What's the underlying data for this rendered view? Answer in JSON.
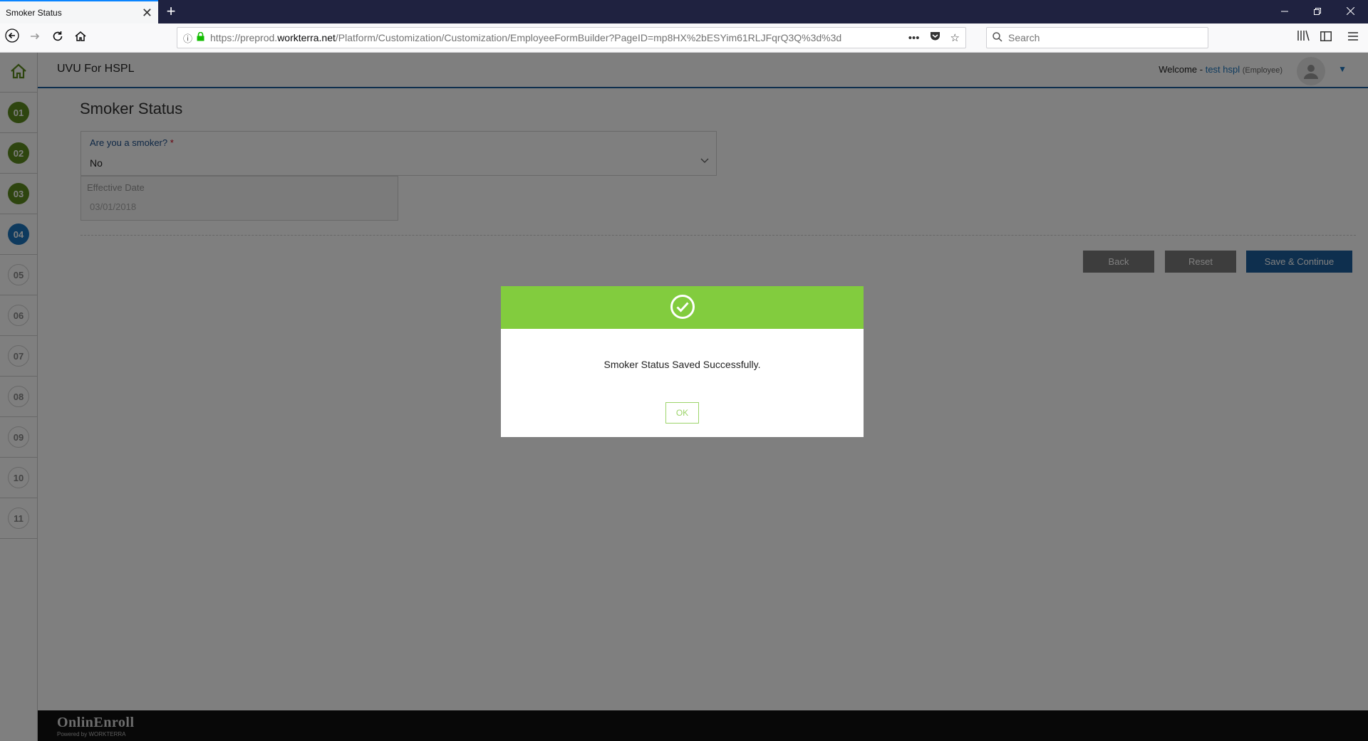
{
  "browser": {
    "tab_title": "Smoker Status",
    "tab_close": "✕",
    "new_tab": "+",
    "url_prefix": "https://preprod.",
    "url_domain": "workterra.net",
    "url_path": "/Platform/Customization/Customization/EmployeeFormBuilder?PageID=mp8HX%2bESYim61RLJFqrQ3Q%3d%3d",
    "search_placeholder": "Search"
  },
  "app": {
    "title": "UVU For HSPL",
    "welcome_label": "Welcome -",
    "user_name": "test hspl",
    "user_role": "(Employee)"
  },
  "steps": [
    {
      "label": "01",
      "state": "done"
    },
    {
      "label": "02",
      "state": "done"
    },
    {
      "label": "03",
      "state": "done"
    },
    {
      "label": "04",
      "state": "current"
    },
    {
      "label": "05",
      "state": "todo"
    },
    {
      "label": "06",
      "state": "todo"
    },
    {
      "label": "07",
      "state": "todo"
    },
    {
      "label": "08",
      "state": "todo"
    },
    {
      "label": "09",
      "state": "todo"
    },
    {
      "label": "10",
      "state": "todo"
    },
    {
      "label": "11",
      "state": "todo"
    }
  ],
  "form": {
    "page_title": "Smoker Status",
    "smoker_label": "Are you a smoker?",
    "required_mark": "*",
    "smoker_value": "No",
    "date_label": "Effective Date",
    "date_value": "03/01/2018",
    "back_label": "Back",
    "reset_label": "Reset",
    "save_label": "Save & Continue"
  },
  "modal": {
    "message": "Smoker Status Saved Successfully.",
    "ok_label": "OK"
  },
  "footer": {
    "logo_text": "OnlinEnroll",
    "powered_by": "Powered by WORKTERRA"
  },
  "colors": {
    "accent_blue": "#1c5f9c",
    "step_done": "#5d8a1e",
    "step_current": "#1c75bc",
    "success_green": "#82cc3e"
  }
}
